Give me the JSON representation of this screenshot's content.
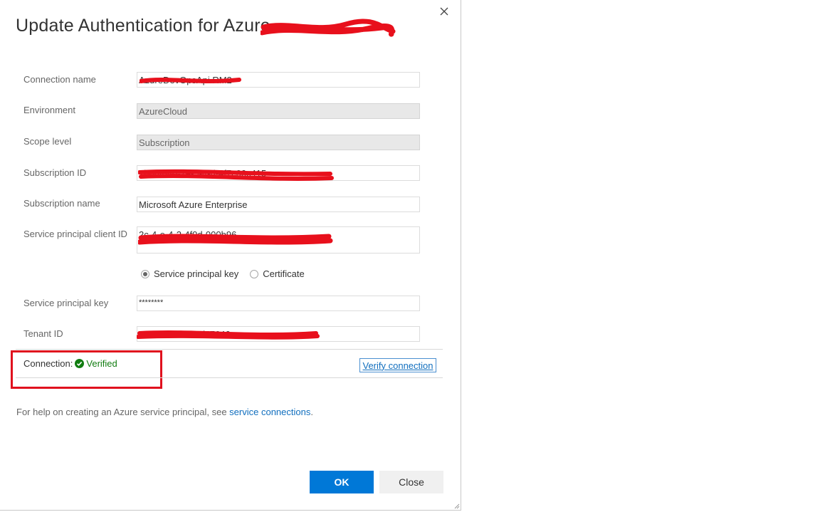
{
  "dialog": {
    "title": "Update Authentication for Azure",
    "close_icon": "close-icon"
  },
  "form": {
    "connection_name": {
      "label": "Connection name",
      "value": "AzureDevOpsApi RM2"
    },
    "environment": {
      "label": "Environment",
      "value": "AzureCloud"
    },
    "scope_level": {
      "label": "Scope level",
      "value": "Subscription"
    },
    "subscription_id": {
      "label": "Subscription ID",
      "value": "7b06f640-7e-5-4-d-4f7c00c415"
    },
    "subscription_name": {
      "label": "Subscription name",
      "value": "Microsoft Azure Enterprise"
    },
    "service_principal_client_id": {
      "label": "Service principal client ID",
      "value": "2c-4-e-4-2-4f0d-000b96"
    },
    "auth_options": [
      {
        "label": "Service principal key",
        "selected": true
      },
      {
        "label": "Certificate",
        "selected": false
      }
    ],
    "service_principal_key": {
      "label": "Service principal key",
      "value": "********"
    },
    "tenant_id": {
      "label": "Tenant ID",
      "value": "39b-4f-3-6f8-c2f57646"
    }
  },
  "connection": {
    "label": "Connection:",
    "status": "Verified",
    "status_icon": "check-circle-icon",
    "verify_label": "Verify connection"
  },
  "help": {
    "text": "For help on creating an Azure service principal, see ",
    "link": "service connections",
    "suffix": "."
  },
  "buttons": {
    "ok": "OK",
    "close": "Close"
  },
  "colors": {
    "primary": "#0078d7",
    "verified": "#107c10",
    "link": "#106ebe",
    "highlight": "#e0111e",
    "redaction": "#e8101c"
  }
}
